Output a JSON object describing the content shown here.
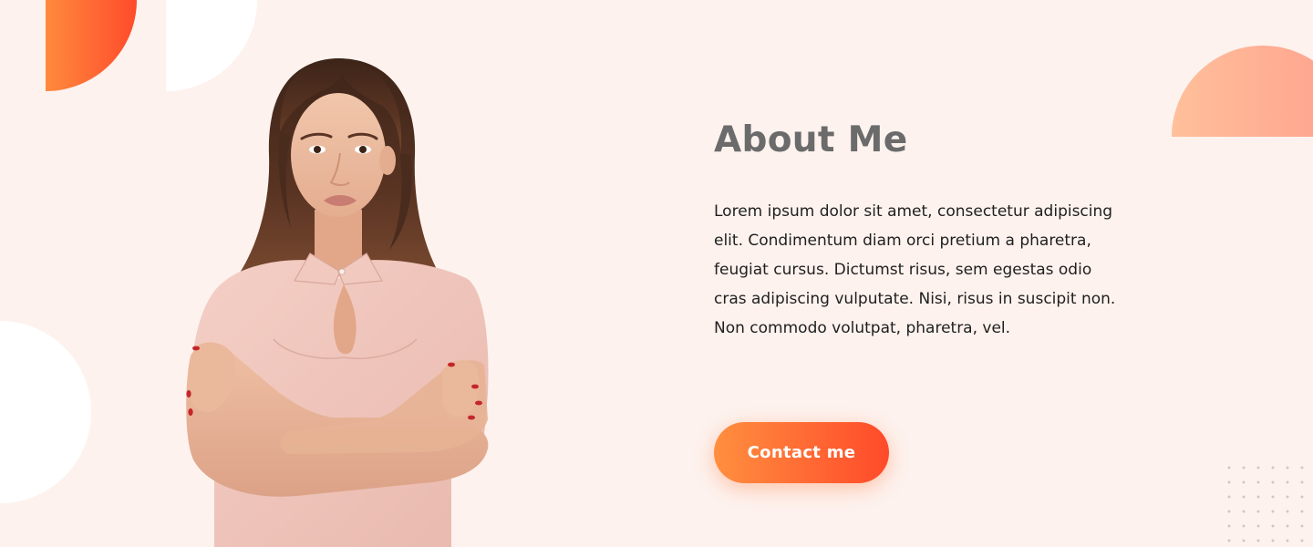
{
  "about": {
    "title": "About Me",
    "body": "Lorem ipsum dolor sit amet, consectetur adipiscing elit. Condimentum diam orci pretium a pharetra, feugiat cursus. Dictumst risus, sem egestas odio cras adipiscing vulputate. Nisi, risus in suscipit non. Non commodo volutpat, pharetra, vel.",
    "button_label": "Contact me"
  },
  "colors": {
    "background": "#fdf2ee",
    "accent_start": "#ff8f3f",
    "accent_end": "#ff4a2a",
    "title": "#6b6b6b",
    "text": "#1f1f1f"
  },
  "portrait": {
    "icon": "woman-portrait-icon"
  }
}
